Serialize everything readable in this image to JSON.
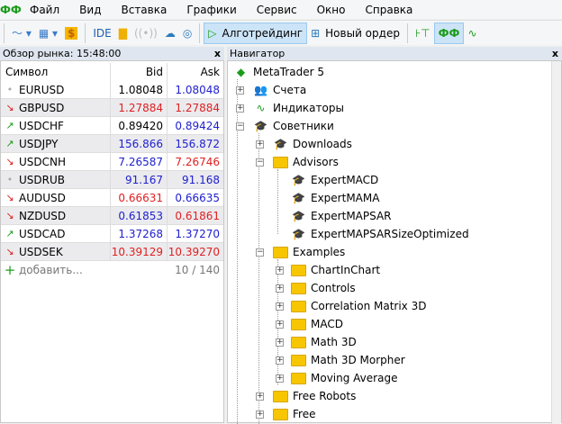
{
  "menu": [
    "Файл",
    "Вид",
    "Вставка",
    "Графики",
    "Сервис",
    "Окно",
    "Справка"
  ],
  "toolbar": {
    "ide": "IDE",
    "algo": "Алготрейдинг",
    "new_order": "Новый ордер"
  },
  "market_watch": {
    "title": "Обзор рынка: 15:48:00",
    "close": "x",
    "headers": {
      "symbol": "Символ",
      "bid": "Bid",
      "ask": "Ask"
    },
    "rows": [
      {
        "symbol": "EURUSD",
        "bid": "1.08048",
        "ask": "1.08048",
        "dir": "none",
        "bid_color": "#000000",
        "ask_color": "#2020d0"
      },
      {
        "symbol": "GBPUSD",
        "bid": "1.27884",
        "ask": "1.27884",
        "dir": "down",
        "bid_color": "#e02020",
        "ask_color": "#e02020"
      },
      {
        "symbol": "USDCHF",
        "bid": "0.89420",
        "ask": "0.89424",
        "dir": "up",
        "bid_color": "#000000",
        "ask_color": "#2020d0"
      },
      {
        "symbol": "USDJPY",
        "bid": "156.866",
        "ask": "156.872",
        "dir": "up",
        "bid_color": "#2020d0",
        "ask_color": "#2020d0"
      },
      {
        "symbol": "USDCNH",
        "bid": "7.26587",
        "ask": "7.26746",
        "dir": "down",
        "bid_color": "#2020d0",
        "ask_color": "#e02020"
      },
      {
        "symbol": "USDRUB",
        "bid": "91.167",
        "ask": "91.168",
        "dir": "none",
        "bid_color": "#2020d0",
        "ask_color": "#2020d0"
      },
      {
        "symbol": "AUDUSD",
        "bid": "0.66631",
        "ask": "0.66635",
        "dir": "down",
        "bid_color": "#e02020",
        "ask_color": "#2020d0"
      },
      {
        "symbol": "NZDUSD",
        "bid": "0.61853",
        "ask": "0.61861",
        "dir": "down",
        "bid_color": "#2020d0",
        "ask_color": "#e02020"
      },
      {
        "symbol": "USDCAD",
        "bid": "1.37268",
        "ask": "1.37270",
        "dir": "up",
        "bid_color": "#2020d0",
        "ask_color": "#2020d0"
      },
      {
        "symbol": "USDSEK",
        "bid": "10.39129",
        "ask": "10.39270",
        "dir": "down",
        "bid_color": "#e02020",
        "ask_color": "#e02020"
      }
    ],
    "add_label": "добавить...",
    "count": "10 / 140"
  },
  "navigator": {
    "title": "Навигатор",
    "close": "x",
    "items": [
      {
        "label": "MetaTrader 5",
        "level": 0,
        "toggle": "",
        "icon": "mt5"
      },
      {
        "label": "Счета",
        "level": 1,
        "toggle": "+",
        "icon": "accounts"
      },
      {
        "label": "Индикаторы",
        "level": 1,
        "toggle": "+",
        "icon": "indicators"
      },
      {
        "label": "Советники",
        "level": 1,
        "toggle": "-",
        "icon": "cap"
      },
      {
        "label": "Downloads",
        "level": 2,
        "toggle": "+",
        "icon": "cap"
      },
      {
        "label": "Advisors",
        "level": 2,
        "toggle": "-",
        "icon": "folder"
      },
      {
        "label": "ExpertMACD",
        "level": 3,
        "toggle": "",
        "icon": "cap"
      },
      {
        "label": "ExpertMAMA",
        "level": 3,
        "toggle": "",
        "icon": "cap"
      },
      {
        "label": "ExpertMAPSAR",
        "level": 3,
        "toggle": "",
        "icon": "cap"
      },
      {
        "label": "ExpertMAPSARSizeOptimized",
        "level": 3,
        "toggle": "",
        "icon": "cap"
      },
      {
        "label": "Examples",
        "level": 2,
        "toggle": "-",
        "icon": "folder"
      },
      {
        "label": "ChartInChart",
        "level": 3,
        "toggle": "+",
        "icon": "folder"
      },
      {
        "label": "Controls",
        "level": 3,
        "toggle": "+",
        "icon": "folder"
      },
      {
        "label": "Correlation Matrix 3D",
        "level": 3,
        "toggle": "+",
        "icon": "folder"
      },
      {
        "label": "MACD",
        "level": 3,
        "toggle": "+",
        "icon": "folder"
      },
      {
        "label": "Math 3D",
        "level": 3,
        "toggle": "+",
        "icon": "folder"
      },
      {
        "label": "Math 3D Morpher",
        "level": 3,
        "toggle": "+",
        "icon": "folder"
      },
      {
        "label": "Moving Average",
        "level": 3,
        "toggle": "+",
        "icon": "folder"
      },
      {
        "label": "Free Robots",
        "level": 2,
        "toggle": "+",
        "icon": "folder"
      },
      {
        "label": "Free",
        "level": 2,
        "toggle": "+",
        "icon": "folder"
      }
    ]
  }
}
